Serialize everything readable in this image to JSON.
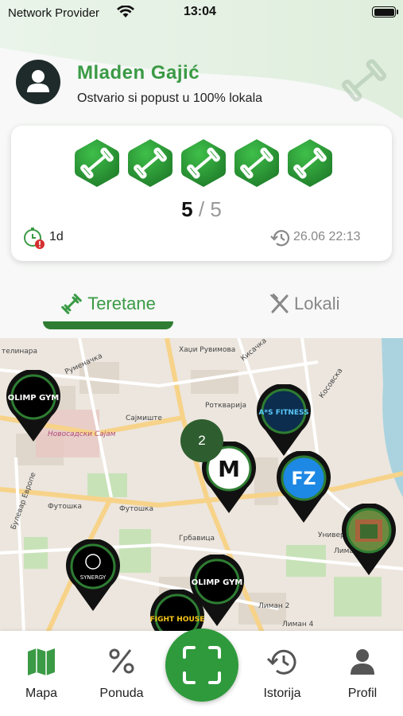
{
  "status_bar": {
    "carrier": "Network Provider",
    "time": "13:04"
  },
  "user": {
    "name": "Mladen Gajić",
    "subtitle": "Ostvario si popust u 100% lokala"
  },
  "card": {
    "badges_icon": "dumbbell-icon",
    "visits_done": "5",
    "separator": "/",
    "visits_total": "5",
    "timer_value": "1d",
    "last_visit": "26.06 22:13"
  },
  "tabs": {
    "gyms": "Teretane",
    "locals": "Lokali"
  },
  "map": {
    "streets": [
      "телинара",
      "Руменачка",
      "Хаџи Рувимова",
      "Кисачка",
      "Косовска",
      "Ротквaрија",
      "Сајмиште",
      "Новосадски Сајам",
      "Футошка",
      "Футошка",
      "Грбавица",
      "Булевар Европе",
      "Лиман 1",
      "Лиман 2",
      "Лиман 4",
      "Универ"
    ],
    "cluster_count": "2",
    "pins": [
      "OLIMP GYM",
      "A*S FITNESS",
      "M",
      "FZ",
      "photo",
      "SYNERGY",
      "OLIMP GYM",
      "FIGHT HOUSE"
    ]
  },
  "nav": {
    "map": "Mapa",
    "offers": "Ponuda",
    "history": "Istorija",
    "profile": "Profil"
  },
  "colors": {
    "accent": "#3a9a45",
    "accent_dark": "#2e7d32"
  }
}
